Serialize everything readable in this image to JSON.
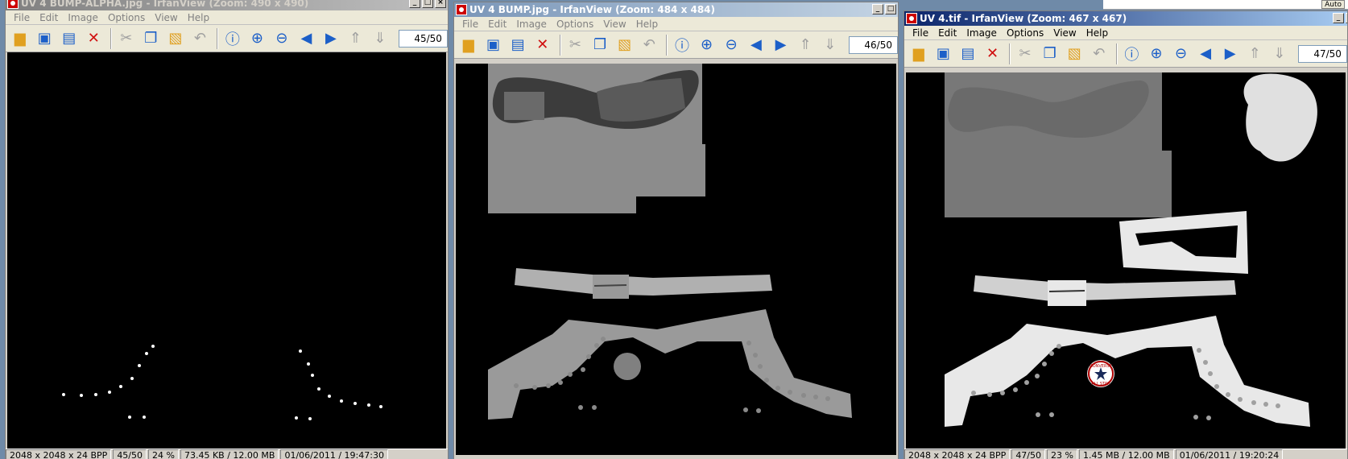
{
  "menu": [
    "File",
    "Edit",
    "Image",
    "Options",
    "View",
    "Help"
  ],
  "windows": [
    {
      "title": "UV 4 BUMP-ALPHA.jpg - IrfanView (Zoom: 490 x 490)",
      "page": "45/50",
      "status": [
        "2048 x 2048 x 24 BPP",
        "45/50",
        "24 %",
        "73.45 KB / 12.00 MB",
        "01/06/2011 / 19:47:30"
      ]
    },
    {
      "title": "UV 4 BUMP.jpg - IrfanView (Zoom: 484 x 484)",
      "page": "46/50"
    },
    {
      "title": "UV 4.tif - IrfanView (Zoom: 467 x 467)",
      "page": "47/50",
      "status": [
        "2048 x 2048 x 24 BPP",
        "47/50",
        "23 %",
        "1.45 MB / 12.00 MB",
        "01/06/2011 / 19:20:24"
      ]
    }
  ],
  "logo_text": [
    "CONVERSE",
    "ALL STAR"
  ],
  "background_window": {
    "button": "Auto"
  },
  "icons": [
    "open-folder-icon",
    "slideshow-icon",
    "save-icon",
    "delete-icon",
    "cut-icon",
    "copy-icon",
    "paste-icon",
    "undo-icon",
    "info-icon",
    "zoom-in-icon",
    "zoom-out-icon",
    "prev-icon",
    "next-icon",
    "first-page-icon",
    "last-page-icon"
  ]
}
